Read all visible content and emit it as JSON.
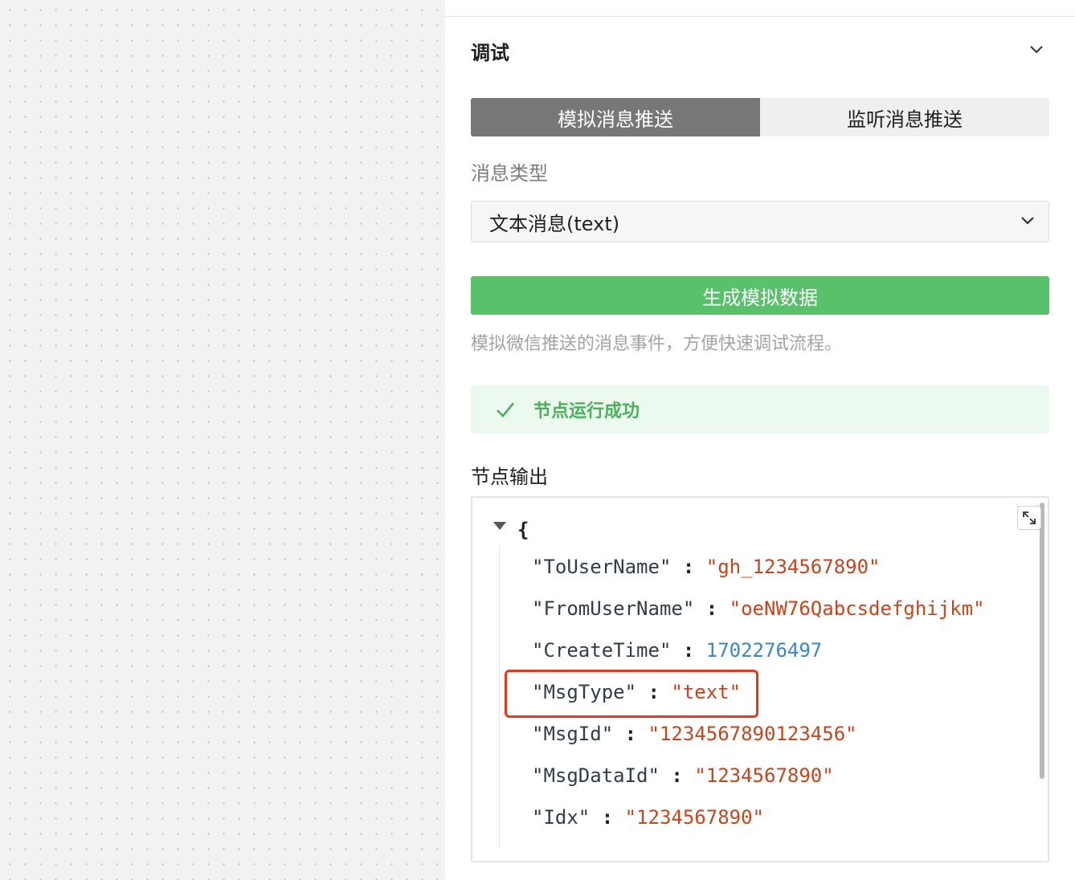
{
  "panel": {
    "title": "调试",
    "tabs": [
      {
        "label": "模拟消息推送",
        "active": true
      },
      {
        "label": "监听消息推送",
        "active": false
      }
    ],
    "message_type_label": "消息类型",
    "message_type_value": "文本消息(text)",
    "generate_button": "生成模拟数据",
    "hint": "模拟微信推送的消息事件，方便快速调试流程。",
    "status_text": "节点运行成功",
    "output_label": "节点输出"
  },
  "json_view": {
    "open_brace": "{",
    "entries": [
      {
        "key": "\"ToUserName\"",
        "value": "\"gh_1234567890\"",
        "type": "string"
      },
      {
        "key": "\"FromUserName\"",
        "value": "\"oeNW76Qabcsdefghijkm\"",
        "type": "string"
      },
      {
        "key": "\"CreateTime\"",
        "value": "1702276497",
        "type": "number"
      },
      {
        "key": "\"MsgType\"",
        "value": "\"text\"",
        "type": "string",
        "highlighted": true
      },
      {
        "key": "\"MsgId\"",
        "value": "\"1234567890123456\"",
        "type": "string"
      },
      {
        "key": "\"MsgDataId\"",
        "value": "\"1234567890\"",
        "type": "string"
      },
      {
        "key": "\"Idx\"",
        "value": "\"1234567890\"",
        "type": "string"
      }
    ],
    "colon": ":"
  },
  "colors": {
    "active_tab": "#777777",
    "primary_green": "#59c16b",
    "success_bg": "#ebf9ee",
    "success_text": "#4caf5b",
    "json_string": "#c4461d",
    "json_number": "#3a86c8",
    "highlight_border": "#e23a22"
  },
  "icons": {
    "collapse": "chevron-down-icon",
    "select": "chevron-down-icon",
    "success": "check-icon",
    "expand": "expand-arrows-icon",
    "toggle": "caret-down-icon"
  }
}
